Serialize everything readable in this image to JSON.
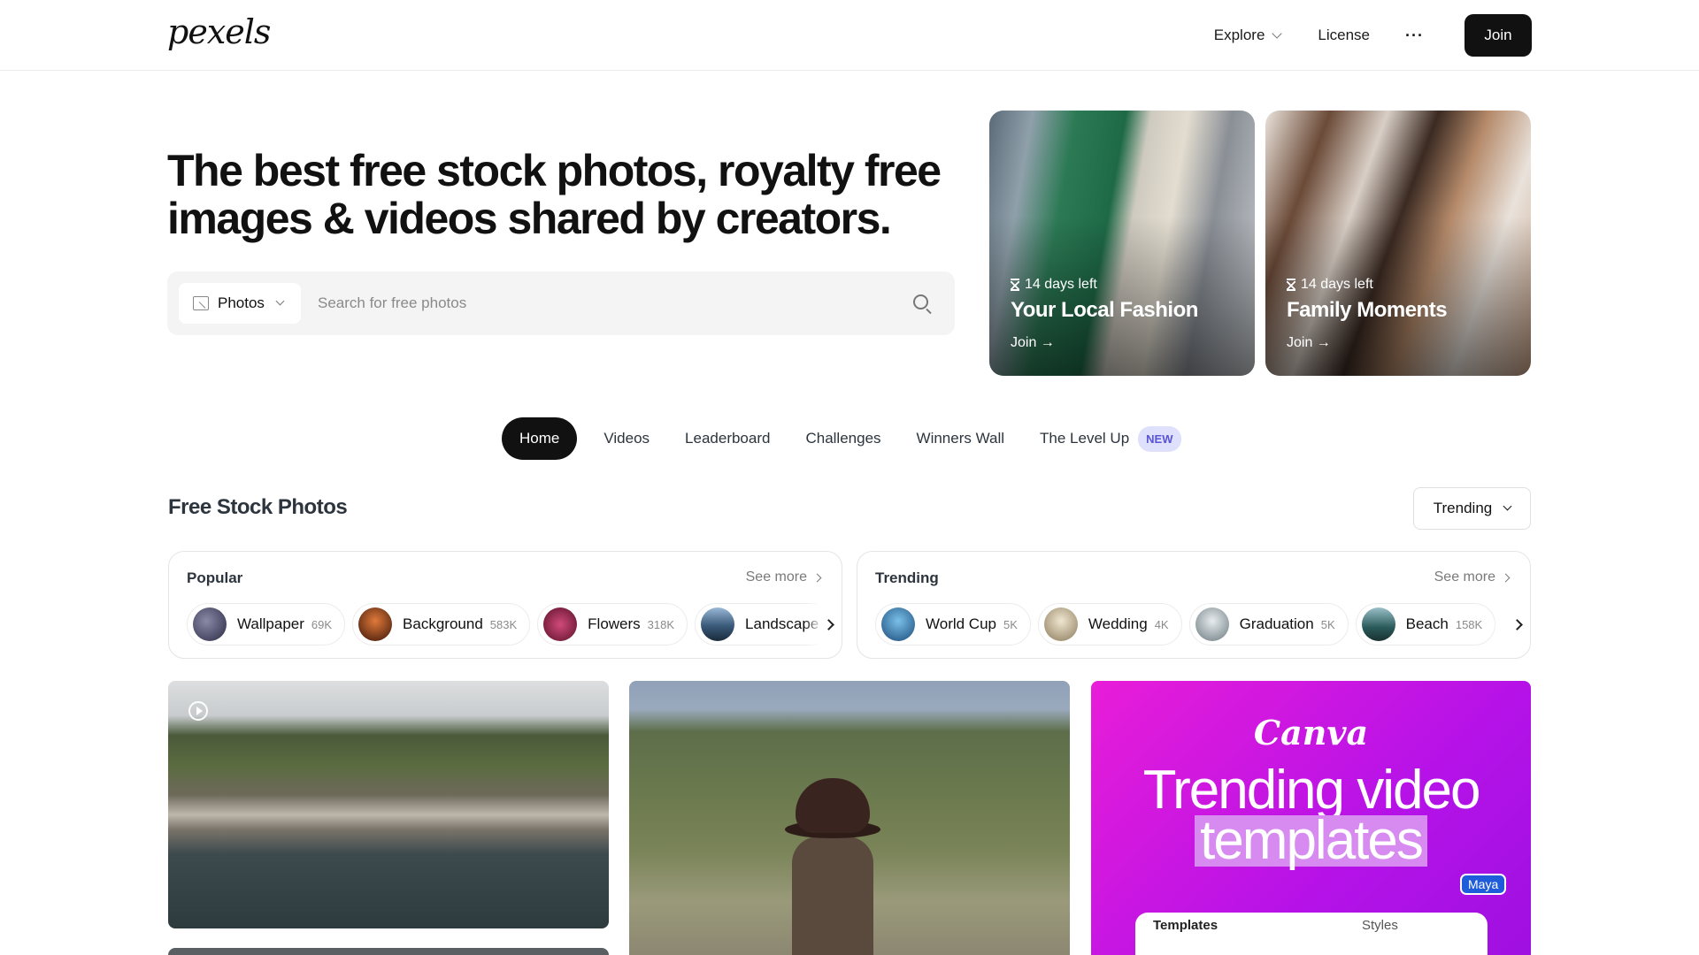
{
  "header": {
    "logo": "pexels",
    "nav": {
      "explore": "Explore",
      "license": "License",
      "more": "···",
      "join": "Join"
    }
  },
  "hero": {
    "title": "The best free stock photos, royalty free images & videos shared by creators.",
    "search": {
      "type_label": "Photos",
      "placeholder": "Search for free photos",
      "icon": "search-icon"
    }
  },
  "challenges": [
    {
      "days_left": "14 days left",
      "title": "Your Local Fashion",
      "join": "Join →"
    },
    {
      "days_left": "14 days left",
      "title": "Family Moments",
      "join": "Join →"
    }
  ],
  "tabs": [
    {
      "label": "Home",
      "active": true
    },
    {
      "label": "Videos"
    },
    {
      "label": "Leaderboard"
    },
    {
      "label": "Challenges"
    },
    {
      "label": "Winners Wall"
    },
    {
      "label": "The Level Up",
      "badge": "NEW"
    }
  ],
  "section": {
    "title": "Free Stock Photos",
    "sort": "Trending"
  },
  "popular": {
    "title": "Popular",
    "see_more": "See more",
    "chips": [
      {
        "label": "Wallpaper",
        "count": "69K",
        "color": "#3b3f5c"
      },
      {
        "label": "Background",
        "count": "583K",
        "color": "#6a2a1a"
      },
      {
        "label": "Flowers",
        "count": "318K",
        "color": "#9a2a4a"
      },
      {
        "label": "Landscape",
        "count": "",
        "color": "#4a6a8a"
      }
    ]
  },
  "trending": {
    "title": "Trending",
    "see_more": "See more",
    "chips": [
      {
        "label": "World Cup",
        "count": "5K",
        "color": "#2a6a9a"
      },
      {
        "label": "Wedding",
        "count": "4K",
        "color": "#c9b89a"
      },
      {
        "label": "Graduation",
        "count": "5K",
        "color": "#8a9aa0"
      },
      {
        "label": "Beach",
        "count": "158K",
        "color": "#2a5a5a"
      }
    ]
  },
  "ad": {
    "brand": "Canva",
    "line1": "Trending video",
    "line2": "templates",
    "tag": "Maya",
    "tab1": "Templates",
    "tab2": "Styles"
  },
  "colors": {
    "accent_dark": "#111111",
    "badge_new_bg": "#dfe0fb",
    "badge_new_text": "#5a54d6",
    "ad_bg": "#e81dd8"
  }
}
